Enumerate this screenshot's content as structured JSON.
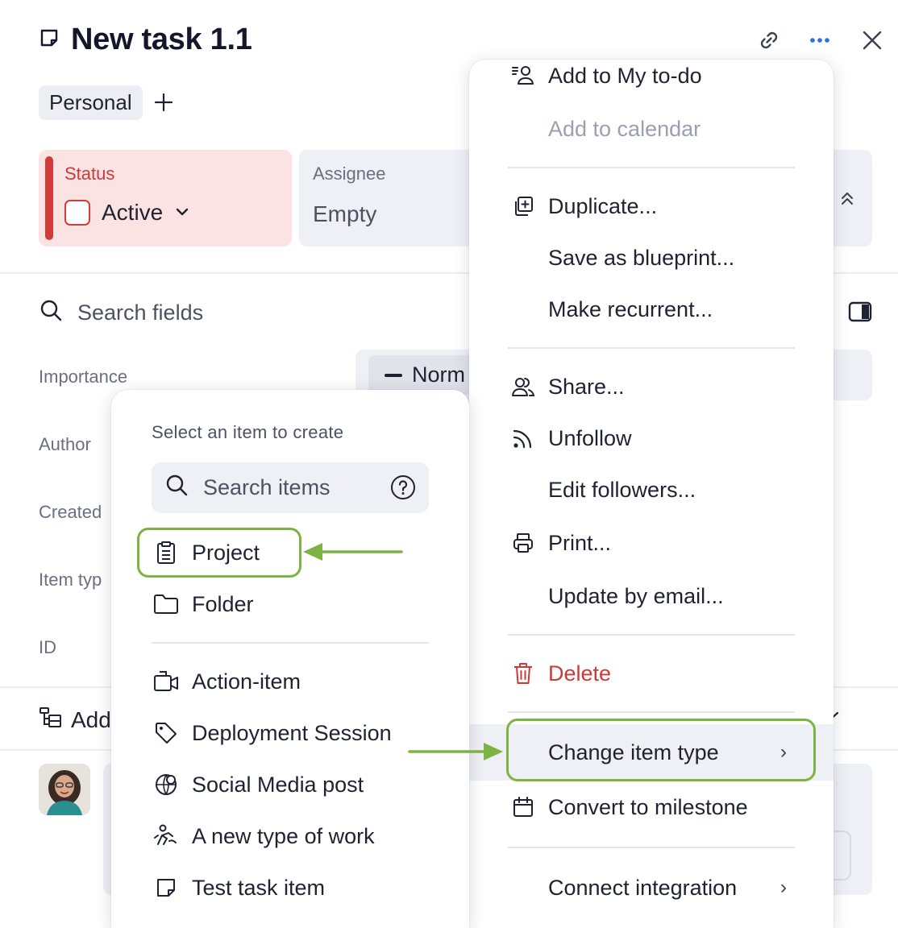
{
  "header": {
    "title": "New task 1.1",
    "tag": "Personal"
  },
  "status_card": {
    "label": "Status",
    "value": "Active"
  },
  "assignee_card": {
    "label": "Assignee",
    "value": "Empty"
  },
  "fields": {
    "search_placeholder": "Search fields",
    "importance_label": "Importance",
    "importance_value": "Norm",
    "author_label": "Author",
    "created_label": "Created",
    "item_type_label": "Item typ",
    "id_label": "ID",
    "add_label": "Add"
  },
  "more_menu": {
    "items": [
      {
        "label": "Add to My to-do",
        "icon": "todo-icon"
      },
      {
        "label": "Add to calendar",
        "disabled": true
      },
      {
        "label": "Duplicate...",
        "icon": "duplicate-icon"
      },
      {
        "label": "Save as blueprint..."
      },
      {
        "label": "Make recurrent..."
      },
      {
        "label": "Share...",
        "icon": "share-users-icon"
      },
      {
        "label": "Unfollow",
        "icon": "rss-icon"
      },
      {
        "label": "Edit followers..."
      },
      {
        "label": "Print...",
        "icon": "printer-icon"
      },
      {
        "label": "Update by email..."
      },
      {
        "label": "Delete",
        "icon": "trash-icon",
        "danger": true
      },
      {
        "label": "Change item type",
        "submenu": true,
        "highlighted": true
      },
      {
        "label": "Convert to milestone",
        "icon": "calendar-icon"
      },
      {
        "label": "Connect integration",
        "submenu": true
      }
    ],
    "chevron": "›"
  },
  "create_menu": {
    "title": "Select an item to create",
    "search_placeholder": "Search items",
    "items": [
      {
        "label": "Project",
        "icon": "project-clipboard-icon",
        "highlighted": true
      },
      {
        "label": "Folder",
        "icon": "folder-icon"
      },
      {
        "label": "Action-item",
        "icon": "action-item-icon"
      },
      {
        "label": "Deployment Session",
        "icon": "tag-icon"
      },
      {
        "label": "Social Media post",
        "icon": "social-media-icon"
      },
      {
        "label": "A new type of work",
        "icon": "new-work-icon"
      },
      {
        "label": "Test task item",
        "icon": "task-icon"
      }
    ]
  },
  "colors": {
    "accent_green": "#7cb342",
    "status_red": "#d23b3b",
    "status_bg": "#fbe3e3",
    "danger_text": "#cc3a3a",
    "link_blue": "#2f6fd6"
  }
}
